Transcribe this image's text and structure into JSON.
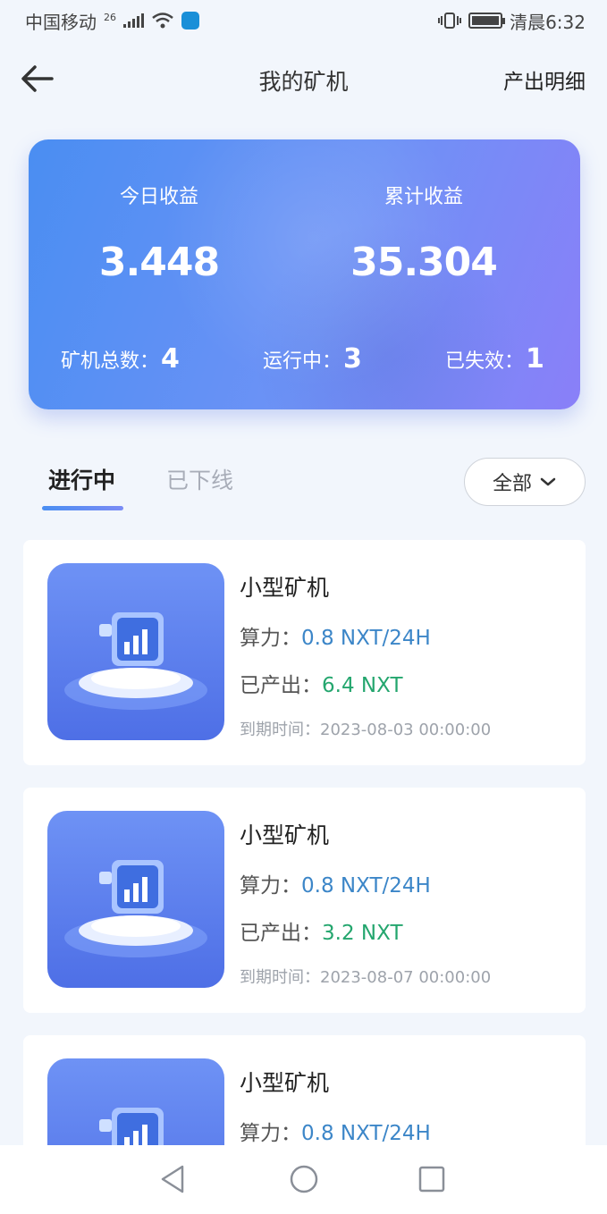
{
  "status_bar": {
    "carrier": "中国移动",
    "network": "26",
    "time": "清晨6:32"
  },
  "header": {
    "title": "我的矿机",
    "detail_link": "产出明细"
  },
  "summary": {
    "today_label": "今日收益",
    "today_value": "3.448",
    "total_label": "累计收益",
    "total_value": "35.304",
    "count_total_label": "矿机总数：",
    "count_total": "4",
    "running_label": "运行中：",
    "running": "3",
    "invalid_label": "已失效：",
    "invalid": "1"
  },
  "tabs": [
    {
      "label": "进行中",
      "active": true
    },
    {
      "label": "已下线",
      "active": false
    }
  ],
  "filter": {
    "label": "全部"
  },
  "labels": {
    "power": "算力：",
    "output": "已产出：",
    "expire": "到期时间："
  },
  "miners": [
    {
      "name": "小型矿机",
      "power": "0.8 NXT/24H",
      "output": "6.4 NXT",
      "expire": "2023-08-03 00:00:00"
    },
    {
      "name": "小型矿机",
      "power": "0.8 NXT/24H",
      "output": "3.2 NXT",
      "expire": "2023-08-07 00:00:00"
    },
    {
      "name": "小型矿机",
      "power": "0.8 NXT/24H"
    }
  ],
  "colors": {
    "card_gradient_start": "#4a8ef2",
    "card_gradient_end": "#8a7ff8",
    "power_value": "#3c86c8",
    "output_value": "#24a66e"
  }
}
